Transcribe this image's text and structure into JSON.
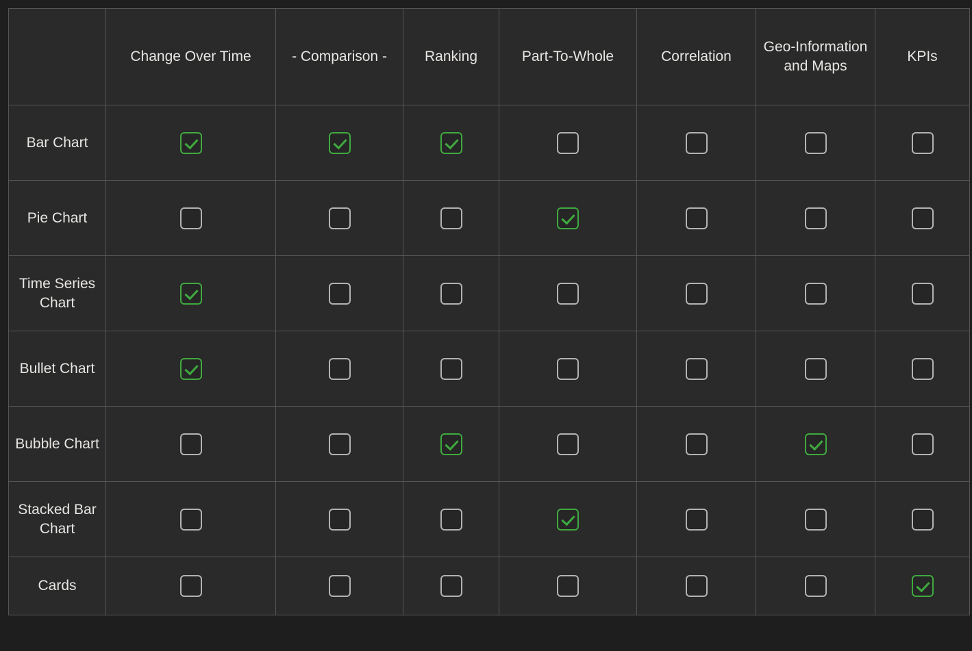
{
  "table": {
    "corner_label": "",
    "columns": [
      {
        "id": "change-over-time",
        "label": "Change Over Time"
      },
      {
        "id": "comparison",
        "label": "- Comparison -"
      },
      {
        "id": "ranking",
        "label": "Ranking"
      },
      {
        "id": "part-to-whole",
        "label": "Part-To-Whole"
      },
      {
        "id": "correlation",
        "label": "Correlation"
      },
      {
        "id": "geo-information-and-maps",
        "label": "Geo-Information and Maps"
      },
      {
        "id": "kpis",
        "label": "KPIs"
      }
    ],
    "rows": [
      {
        "id": "bar-chart",
        "label": "Bar Chart",
        "values": [
          true,
          true,
          true,
          false,
          false,
          false,
          false
        ]
      },
      {
        "id": "pie-chart",
        "label": "Pie Chart",
        "values": [
          false,
          false,
          false,
          true,
          false,
          false,
          false
        ]
      },
      {
        "id": "time-series-chart",
        "label": "Time Series Chart",
        "values": [
          true,
          false,
          false,
          false,
          false,
          false,
          false
        ]
      },
      {
        "id": "bullet-chart",
        "label": "Bullet Chart",
        "values": [
          true,
          false,
          false,
          false,
          false,
          false,
          false
        ]
      },
      {
        "id": "bubble-chart",
        "label": "Bubble Chart",
        "values": [
          false,
          false,
          true,
          false,
          false,
          true,
          false
        ]
      },
      {
        "id": "stacked-bar-chart",
        "label": "Stacked Bar Chart",
        "values": [
          false,
          false,
          false,
          true,
          false,
          false,
          false
        ]
      },
      {
        "id": "cards",
        "label": "Cards",
        "values": [
          false,
          false,
          false,
          false,
          false,
          false,
          true
        ]
      }
    ]
  },
  "icons": {
    "checked": "checkbox-checked-icon",
    "unchecked": "checkbox-unchecked-icon"
  },
  "colors": {
    "page_background": "#1e1e1e",
    "cell_background": "#2a2a2a",
    "grid_border": "#565656",
    "text": "#e8e6e3",
    "checked_accent": "#3faa3f",
    "unchecked_border": "#b3b3b3"
  }
}
